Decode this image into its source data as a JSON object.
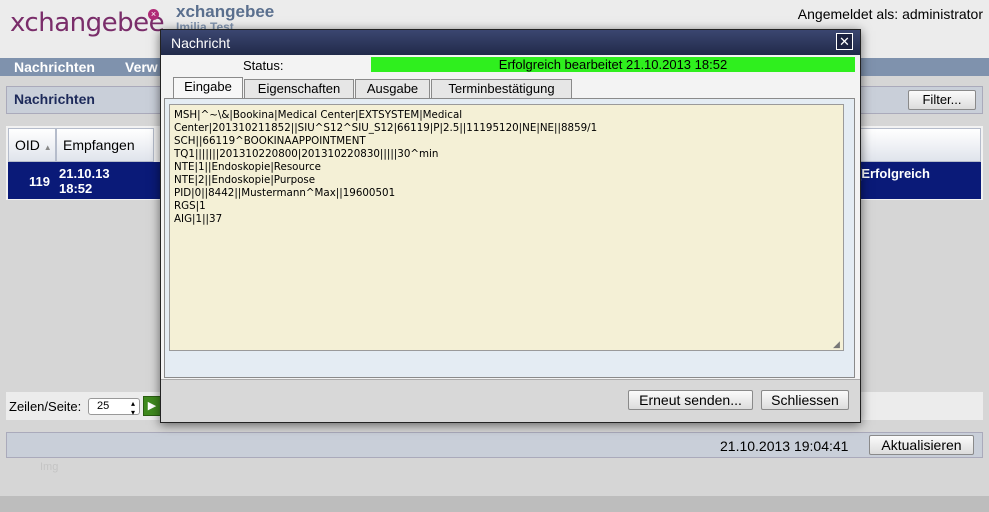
{
  "app": {
    "logo_text": "xchangebee",
    "logo_mark": "×",
    "name": "xchangebee",
    "subtitle": "Imilia Test",
    "login": "Angemeldet als: administrator"
  },
  "nav": {
    "items": [
      "Nachrichten",
      "Verw"
    ]
  },
  "page": {
    "title": "Nachrichten",
    "filter_label": "Filter..."
  },
  "table": {
    "columns": [
      "OID",
      "Empfangen"
    ],
    "sort_indicator": "▲",
    "row": {
      "oid": "119",
      "received_date": "21.10.13",
      "received_time": "18:52",
      "status": "[Erfolgreich"
    }
  },
  "pager": {
    "rows_label": "Zeilen/Seite:",
    "per_page": "25",
    "next_glyph": "▶"
  },
  "footer": {
    "timestamp": "21.10.2013 19:04:41",
    "refresh_label": "Aktualisieren",
    "ghost_text": "Img"
  },
  "modal": {
    "title": "Nachricht",
    "close_glyph": "✕",
    "status_label": "Status:",
    "status_value": "Erfolgreich bearbeitet 21.10.2013 18:52",
    "status_color": "#2fef1e",
    "tabs": [
      "Eingabe",
      "Eigenschaften",
      "Ausgabe",
      "Terminbestätigung"
    ],
    "message": "MSH|^~\\&|Bookina|Medical Center|EXTSYSTEM|Medical\nCenter|201310211852||SIU^S12^SIU_S12|66119|P|2.5||11195120|NE|NE||8859/1\nSCH||66119^BOOKINAAPPOINTMENT\nTQ1|||||||201310220800|201310220830|||||30^min\nNTE|1||Endoskopie|Resource\nNTE|2||Endoskopie|Purpose\nPID|0||8442||Mustermann^Max||19600501\nRGS|1\nAIG|1||37",
    "resend_label": "Erneut senden...",
    "close_label": "Schliessen"
  }
}
